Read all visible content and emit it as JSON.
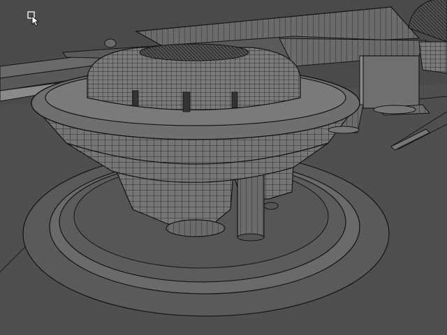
{
  "viewport": {
    "mode": "3d-wireframe-shaded",
    "background_color": "#4a4a4a",
    "floor_color": "#4f4f4f",
    "model_fill_color": "#6e6e6e",
    "wire_color": "#141414"
  },
  "cursor": {
    "type": "select-arrow-with-box",
    "icon": "selection-cursor-icon"
  }
}
